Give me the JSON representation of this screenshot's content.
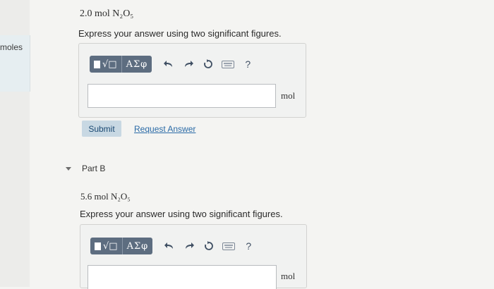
{
  "sidebar": {
    "tab_label": "moles"
  },
  "part_a": {
    "question": "2.0 mol N₂O₅",
    "instruction": "Express your answer using two significant figures.",
    "toolbar": {
      "sqrt_label": "√□",
      "greek_label": "AΣφ",
      "undo_icon": "undo-icon",
      "redo_icon": "redo-icon",
      "reset_icon": "reset-icon",
      "keyboard_icon": "keyboard-icon",
      "help_label": "?"
    },
    "answer_value": "",
    "unit": "mol",
    "submit_label": "Submit",
    "request_label": "Request Answer"
  },
  "part_b": {
    "label": "Part B",
    "question": "5.6 mol N₂O₅",
    "instruction": "Express your answer using two significant figures.",
    "toolbar": {
      "sqrt_label": "√□",
      "greek_label": "AΣφ",
      "help_label": "?"
    },
    "answer_value": "",
    "unit": "mol"
  },
  "colors": {
    "toolbar_bg": "#5d6d80",
    "link": "#2a6aa6",
    "submit_bg": "#c8d8e3"
  }
}
